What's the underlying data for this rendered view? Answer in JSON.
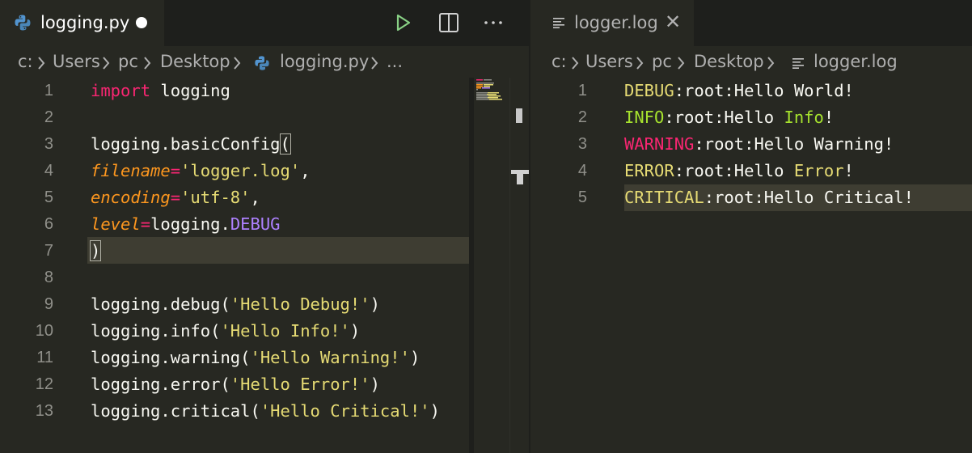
{
  "colors": {
    "background": "#272822",
    "tabbar": "#1e1f1c",
    "keyword": "#f92672",
    "string": "#e6db74",
    "parameter": "#fd971f",
    "constant": "#ae81ff",
    "info_green": "#a6e22e",
    "run_green": "#89d185"
  },
  "left_editor": {
    "tab": {
      "label": "logging.py",
      "icon": "python-icon",
      "dirty": true
    },
    "actions": [
      {
        "icon": "run-icon"
      },
      {
        "icon": "split-editor-icon"
      },
      {
        "icon": "more-actions-icon"
      }
    ],
    "breadcrumb": [
      "c:",
      "Users",
      "pc",
      "Desktop",
      "logging.py",
      "..."
    ],
    "lines": [
      {
        "n": "1",
        "tokens": [
          {
            "t": "import",
            "c": "kw"
          },
          {
            "t": " logging",
            "c": ""
          }
        ]
      },
      {
        "n": "2",
        "tokens": []
      },
      {
        "n": "3",
        "tokens": [
          {
            "t": "logging.basicConfig",
            "c": ""
          },
          {
            "t": "(",
            "c": "bracket"
          }
        ]
      },
      {
        "n": "4",
        "tokens": [
          {
            "t": "filename",
            "c": "param"
          },
          {
            "t": "=",
            "c": "op"
          },
          {
            "t": "'logger.log'",
            "c": "str"
          },
          {
            "t": ",",
            "c": ""
          }
        ]
      },
      {
        "n": "5",
        "tokens": [
          {
            "t": "encoding",
            "c": "param"
          },
          {
            "t": "=",
            "c": "op"
          },
          {
            "t": "'utf-8'",
            "c": "str"
          },
          {
            "t": ",",
            "c": ""
          }
        ]
      },
      {
        "n": "6",
        "tokens": [
          {
            "t": "level",
            "c": "param"
          },
          {
            "t": "=",
            "c": "op"
          },
          {
            "t": "logging.",
            "c": ""
          },
          {
            "t": "DEBUG",
            "c": "const"
          }
        ]
      },
      {
        "n": "7",
        "tokens": [
          {
            "t": ")",
            "c": "bracket"
          }
        ],
        "current": true
      },
      {
        "n": "8",
        "tokens": []
      },
      {
        "n": "9",
        "tokens": [
          {
            "t": "logging.debug(",
            "c": ""
          },
          {
            "t": "'Hello Debug!'",
            "c": "str"
          },
          {
            "t": ")",
            "c": ""
          }
        ]
      },
      {
        "n": "10",
        "tokens": [
          {
            "t": "logging.info(",
            "c": ""
          },
          {
            "t": "'Hello Info!'",
            "c": "str"
          },
          {
            "t": ")",
            "c": ""
          }
        ]
      },
      {
        "n": "11",
        "tokens": [
          {
            "t": "logging.warning(",
            "c": ""
          },
          {
            "t": "'Hello Warning!'",
            "c": "str"
          },
          {
            "t": ")",
            "c": ""
          }
        ]
      },
      {
        "n": "12",
        "tokens": [
          {
            "t": "logging.error(",
            "c": ""
          },
          {
            "t": "'Hello Error!'",
            "c": "str"
          },
          {
            "t": ")",
            "c": ""
          }
        ]
      },
      {
        "n": "13",
        "tokens": [
          {
            "t": "logging.critical(",
            "c": ""
          },
          {
            "t": "'Hello Critical!'",
            "c": "str"
          },
          {
            "t": ")",
            "c": ""
          }
        ]
      }
    ]
  },
  "right_editor": {
    "tab": {
      "label": "logger.log",
      "icon": "file-lines-icon",
      "close_icon": "close-icon",
      "close_glyph": "✕"
    },
    "breadcrumb": [
      "c:",
      "Users",
      "pc",
      "Desktop",
      "logger.log"
    ],
    "lines": [
      {
        "n": "1",
        "tokens": [
          {
            "t": "DEBUG",
            "c": "lv-debug"
          },
          {
            "t": ":root:Hello World!",
            "c": ""
          }
        ]
      },
      {
        "n": "2",
        "tokens": [
          {
            "t": "INFO",
            "c": "lv-info"
          },
          {
            "t": ":root:Hello ",
            "c": ""
          },
          {
            "t": "Info",
            "c": "hl-info"
          },
          {
            "t": "!",
            "c": ""
          }
        ]
      },
      {
        "n": "3",
        "tokens": [
          {
            "t": "WARNING",
            "c": "lv-warning"
          },
          {
            "t": ":root:Hello Warning!",
            "c": ""
          }
        ]
      },
      {
        "n": "4",
        "tokens": [
          {
            "t": "ERROR",
            "c": "lv-error"
          },
          {
            "t": ":root:Hello ",
            "c": ""
          },
          {
            "t": "Error",
            "c": "hl-error"
          },
          {
            "t": "!",
            "c": ""
          }
        ]
      },
      {
        "n": "5",
        "tokens": [
          {
            "t": "CRITICAL",
            "c": "lv-critical"
          },
          {
            "t": ":root:Hello Critical!",
            "c": ""
          }
        ],
        "current": true
      }
    ]
  }
}
